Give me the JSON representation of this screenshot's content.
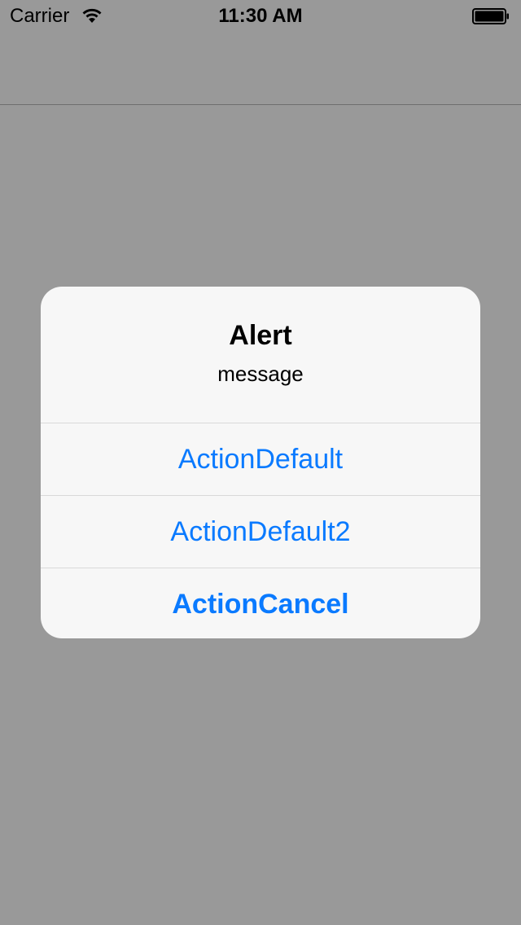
{
  "status_bar": {
    "carrier": "Carrier",
    "time": "11:30 AM",
    "wifi_icon": "wifi-icon",
    "battery_icon": "battery-full-icon"
  },
  "alert": {
    "title": "Alert",
    "message": "message",
    "actions": [
      {
        "label": "ActionDefault",
        "style": "default"
      },
      {
        "label": "ActionDefault2",
        "style": "default"
      },
      {
        "label": "ActionCancel",
        "style": "cancel"
      }
    ]
  },
  "colors": {
    "overlay": "#999999",
    "alert_background": "#f7f7f7",
    "action_tint": "#0a7aff",
    "separator": "#d9d9d9"
  }
}
